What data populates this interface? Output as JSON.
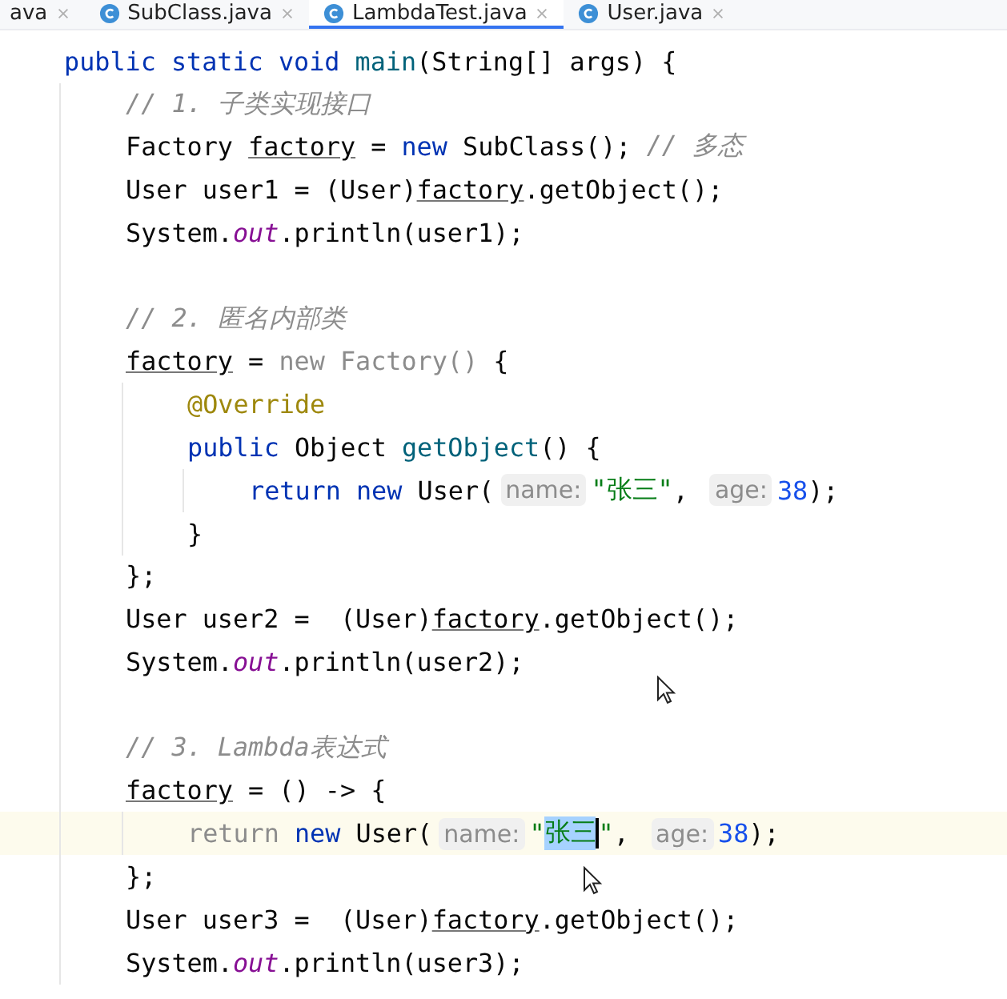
{
  "tabs": [
    {
      "label": "ava",
      "icon": false,
      "selected": false
    },
    {
      "label": "SubClass.java",
      "icon": true,
      "selected": false
    },
    {
      "label": "LambdaTest.java",
      "icon": true,
      "selected": true
    },
    {
      "label": "User.java",
      "icon": true,
      "selected": false
    }
  ],
  "lines": [
    {
      "current": false,
      "tokens": [
        {
          "kind": "kw",
          "text": "public static void "
        },
        {
          "kind": "method",
          "text": "main"
        },
        {
          "kind": "plain",
          "text": "(String[] args) {"
        }
      ],
      "children": [
        {
          "current": false,
          "tokens": [
            {
              "kind": "comment",
              "text": "// 1. 子类实现接口"
            }
          ]
        },
        {
          "current": false,
          "tokens": [
            {
              "kind": "plain",
              "text": "Factory "
            },
            {
              "kind": "var",
              "text": "factory"
            },
            {
              "kind": "plain",
              "text": " = "
            },
            {
              "kind": "kw",
              "text": "new "
            },
            {
              "kind": "plain",
              "text": "SubClass(); "
            },
            {
              "kind": "comment",
              "text": "// 多态"
            }
          ]
        },
        {
          "current": false,
          "tokens": [
            {
              "kind": "plain",
              "text": "User user1 = (User)"
            },
            {
              "kind": "var",
              "text": "factory"
            },
            {
              "kind": "plain",
              "text": ".getObject();"
            }
          ]
        },
        {
          "current": false,
          "tokens": [
            {
              "kind": "plain",
              "text": "System."
            },
            {
              "kind": "field",
              "text": "out"
            },
            {
              "kind": "plain",
              "text": ".println(user1);"
            }
          ]
        },
        {
          "current": false
        },
        {
          "current": false,
          "tokens": [
            {
              "kind": "comment",
              "text": "// 2. 匿名内部类"
            }
          ]
        },
        {
          "current": false,
          "tokens": [
            {
              "kind": "var",
              "text": "factory"
            },
            {
              "kind": "plain",
              "text": " = "
            },
            {
              "kind": "dim",
              "text": "new Factory()"
            },
            {
              "kind": "plain",
              "text": " {"
            }
          ],
          "children": [
            {
              "current": false,
              "tokens": [
                {
                  "kind": "annotation",
                  "text": "@Override"
                }
              ]
            },
            {
              "current": false,
              "tokens": [
                {
                  "kind": "kw",
                  "text": "public "
                },
                {
                  "kind": "plain",
                  "text": "Object "
                },
                {
                  "kind": "method",
                  "text": "getObject"
                },
                {
                  "kind": "plain",
                  "text": "() {"
                }
              ],
              "children": [
                {
                  "current": false,
                  "tokens": [
                    {
                      "kind": "kw",
                      "text": "return new "
                    },
                    {
                      "kind": "plain",
                      "text": "User("
                    },
                    {
                      "kind": "hint",
                      "text": "name:"
                    },
                    {
                      "kind": "string",
                      "text": "\"张三\""
                    },
                    {
                      "kind": "plain",
                      "text": ", "
                    },
                    {
                      "kind": "hint",
                      "text": "age:"
                    },
                    {
                      "kind": "number",
                      "text": "38"
                    },
                    {
                      "kind": "plain",
                      "text": ");"
                    }
                  ]
                }
              ]
            },
            {
              "current": false,
              "tokens": [
                {
                  "kind": "plain",
                  "text": "}"
                }
              ]
            }
          ]
        },
        {
          "current": false,
          "tokens": [
            {
              "kind": "plain",
              "text": "};"
            }
          ]
        },
        {
          "current": false,
          "tokens": [
            {
              "kind": "plain",
              "text": "User user2 =  (User)"
            },
            {
              "kind": "var",
              "text": "factory"
            },
            {
              "kind": "plain",
              "text": ".getObject();"
            }
          ]
        },
        {
          "current": false,
          "tokens": [
            {
              "kind": "plain",
              "text": "System."
            },
            {
              "kind": "field",
              "text": "out"
            },
            {
              "kind": "plain",
              "text": ".println(user2);"
            }
          ]
        },
        {
          "current": false
        },
        {
          "current": false,
          "tokens": [
            {
              "kind": "comment",
              "text": "// 3. Lambda表达式"
            }
          ]
        },
        {
          "current": false,
          "tokens": [
            {
              "kind": "var",
              "text": "factory"
            },
            {
              "kind": "plain",
              "text": " = () -> {"
            }
          ],
          "children": [
            {
              "current": true,
              "tokens": [
                {
                  "kind": "dim",
                  "text": "return "
                },
                {
                  "kind": "kw",
                  "text": "new "
                },
                {
                  "kind": "plain",
                  "text": "User("
                },
                {
                  "kind": "hint",
                  "text": "name:"
                },
                {
                  "kind": "string",
                  "text": "\""
                },
                {
                  "kind": "string-selected",
                  "text": "张三"
                },
                {
                  "kind": "string",
                  "text": "\""
                },
                {
                  "kind": "plain",
                  "text": ", "
                },
                {
                  "kind": "hint",
                  "text": "age:"
                },
                {
                  "kind": "number",
                  "text": "38"
                },
                {
                  "kind": "plain",
                  "text": ");"
                }
              ]
            }
          ]
        },
        {
          "current": false,
          "tokens": [
            {
              "kind": "plain",
              "text": "};"
            }
          ]
        },
        {
          "current": false,
          "tokens": [
            {
              "kind": "plain",
              "text": "User user3 =  (User)"
            },
            {
              "kind": "var",
              "text": "factory"
            },
            {
              "kind": "plain",
              "text": ".getObject();"
            }
          ]
        },
        {
          "current": false,
          "tokens": [
            {
              "kind": "plain",
              "text": "System."
            },
            {
              "kind": "field",
              "text": "out"
            },
            {
              "kind": "plain",
              "text": ".println(user3);"
            }
          ]
        }
      ]
    }
  ]
}
